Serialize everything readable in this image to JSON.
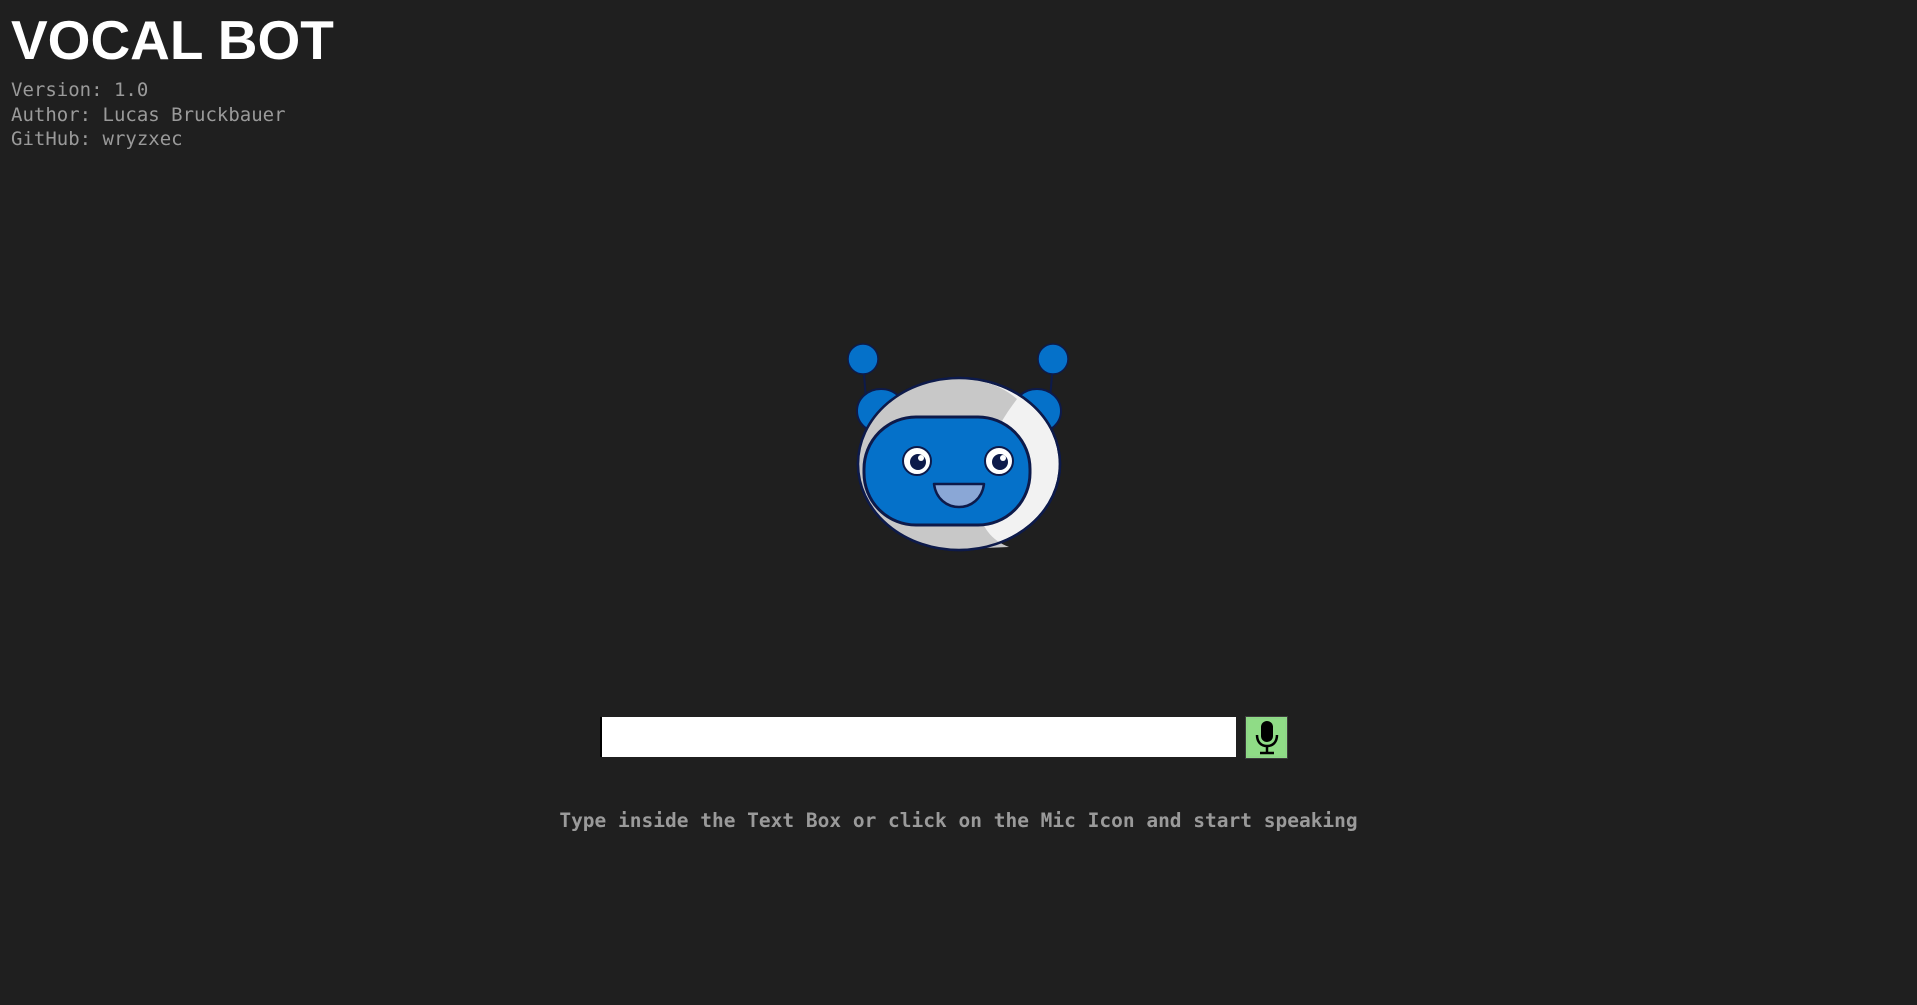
{
  "header": {
    "title": "VOCAL BOT",
    "version": "Version: 1.0",
    "author": "Author: Lucas Bruckbauer",
    "github": "GitHub: wryzxec"
  },
  "bot": {
    "icon": "robot-face-icon",
    "colors": {
      "accent_blue": "#0571c9",
      "helmet_light": "#f2f2f2",
      "helmet_shade": "#c8c8c8",
      "outline": "#0d1a4a",
      "mouth": "#8aa7d6"
    }
  },
  "input": {
    "value": "",
    "placeholder": ""
  },
  "mic_button": {
    "icon": "microphone-icon",
    "color": "#8fdc86"
  },
  "hint": "Type inside the Text Box or click on the Mic Icon and start speaking",
  "colors": {
    "background": "#1f1f1f",
    "title": "#ffffff",
    "muted_text": "#9a9a9a"
  }
}
